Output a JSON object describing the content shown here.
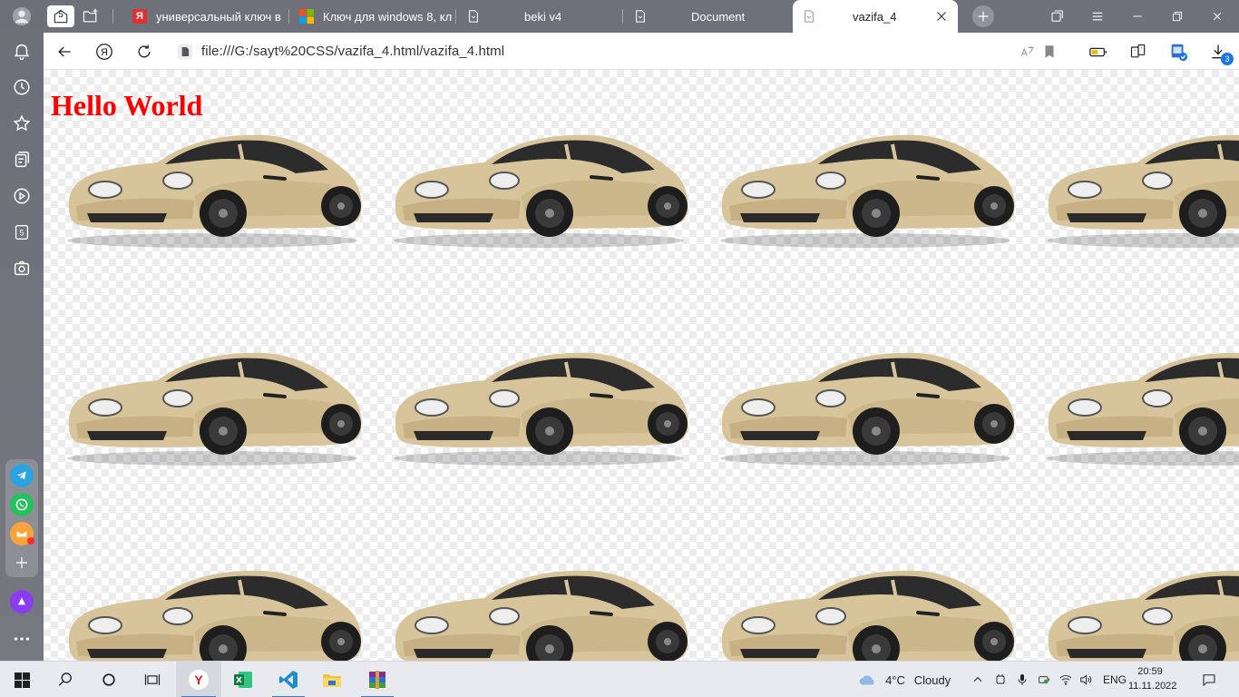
{
  "sidebar": {
    "profile_icon": "user-icon",
    "badge_text": "5",
    "items": [
      "bell-icon",
      "history-icon",
      "star-icon",
      "collections-icon",
      "play-icon",
      "five-icon",
      "screenshot-icon"
    ],
    "apps": [
      "telegram-icon",
      "whatsapp-icon",
      "mail-icon",
      "add-icon"
    ],
    "alice_icon": "alice-icon",
    "more_icon": "more-icon"
  },
  "tabs": [
    {
      "title": "универсальный ключ в",
      "icon": "yandex-icon"
    },
    {
      "title": "Ключ для windows 8, кл",
      "icon": "windows-icon"
    },
    {
      "title": "beki v4",
      "icon": "file-icon"
    },
    {
      "title": "Document",
      "icon": "file-icon"
    },
    {
      "title": "vazifa_4",
      "icon": "file-icon",
      "active": true
    }
  ],
  "tabstrip": {
    "badge_text": "5"
  },
  "address_bar": {
    "url": "file:///G:/sayt%20CSS/vazifa_4.html/vazifa_4.html",
    "downloads_count": "3"
  },
  "page": {
    "heading": "Hello World",
    "heading_color": "#ff0000",
    "background_image": "car-image-tile"
  },
  "taskbar": {
    "apps": [
      "yandex-browser-icon",
      "excel-icon",
      "vscode-icon",
      "file-explorer-icon",
      "winrar-icon"
    ],
    "weather_temp": "4°C",
    "weather_desc": "Cloudy",
    "language": "ENG",
    "time": "20:59",
    "date": "11.11.2022"
  }
}
